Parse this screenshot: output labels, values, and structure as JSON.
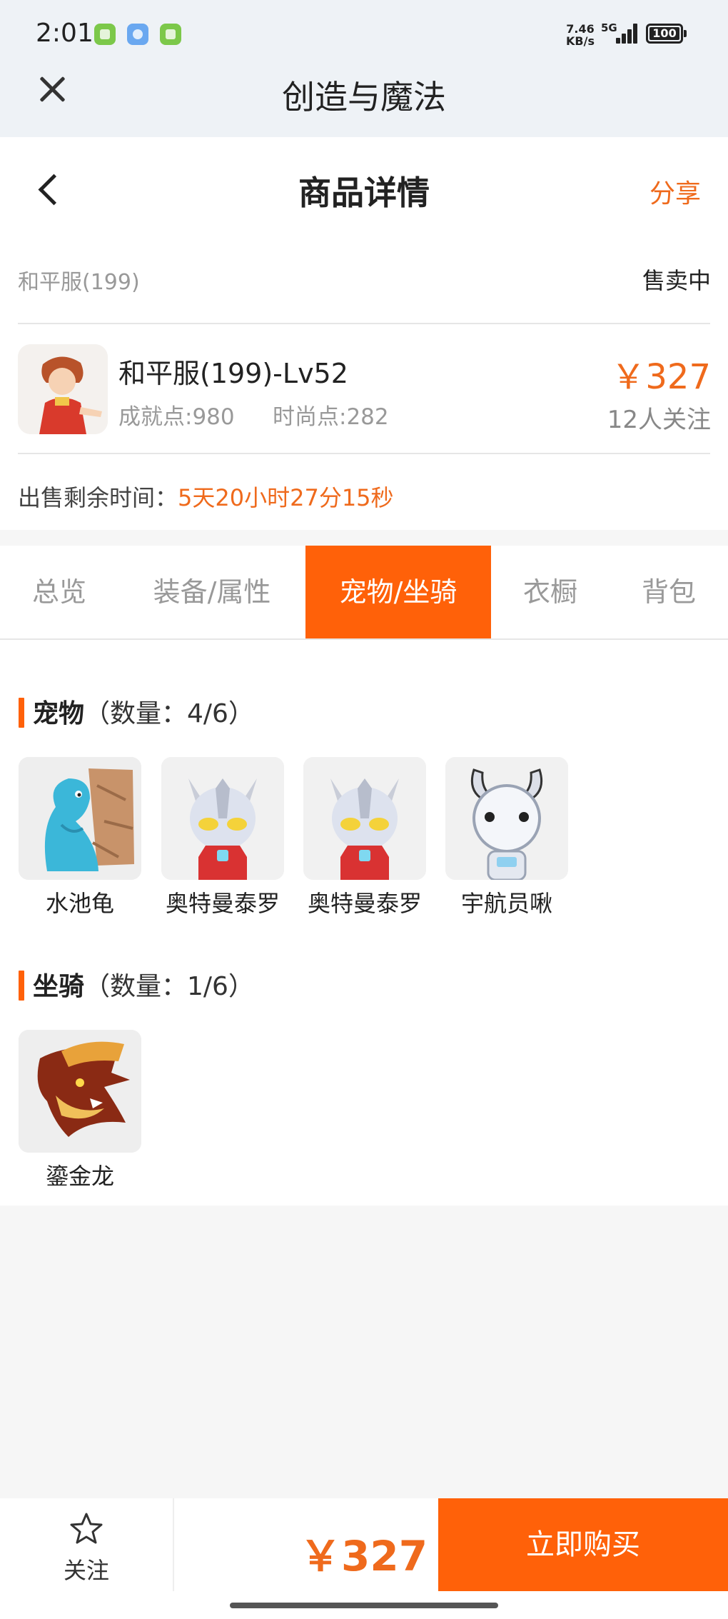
{
  "status_bar": {
    "time": "2:01",
    "net_speed_value": "7.46",
    "net_speed_unit": "KB/s",
    "network": "5G",
    "battery": "100",
    "icons": [
      "wechat-icon",
      "app-circle-icon",
      "message-icon"
    ],
    "icon_colors": [
      "#7cc84a",
      "#6aa8f0",
      "#7cc84a"
    ]
  },
  "mini_app": {
    "title": "创造与魔法",
    "close_icon": "close-icon"
  },
  "nav": {
    "title": "商品详情",
    "share": "分享",
    "back_icon": "chevron-left-icon"
  },
  "product": {
    "name": "和平服(199)",
    "status": "售卖中",
    "title": "和平服(199)-Lv52",
    "achievement": "成就点:980",
    "fashion": "时尚点:282",
    "price": "￥327",
    "followers": "12人关注",
    "countdown_label": "出售剩余时间：",
    "countdown_value": "5天20小时27分15秒"
  },
  "tabs": [
    "总览",
    "装备/属性",
    "宠物/坐骑",
    "衣橱",
    "背包"
  ],
  "active_tab": 2,
  "pets": {
    "title": "宠物",
    "count": "（数量：4/6）",
    "items": [
      {
        "name": "水池龟"
      },
      {
        "name": "奥特曼泰罗"
      },
      {
        "name": "奥特曼泰罗"
      },
      {
        "name": "宇航员啾"
      }
    ]
  },
  "mounts": {
    "title": "坐骑",
    "count": "（数量：1/6）",
    "items": [
      {
        "name": "鎏金龙"
      }
    ]
  },
  "bottom_bar": {
    "follow": "关注",
    "price": "￥327",
    "buy": "立即购买"
  },
  "colors": {
    "accent": "#ff6109",
    "price": "#ef6a1c"
  }
}
